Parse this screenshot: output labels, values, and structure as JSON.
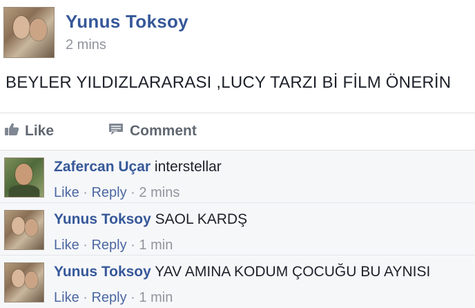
{
  "post": {
    "author": "Yunus Toksoy",
    "time": "2 mins",
    "text": "BEYLER YILDIZLARARASI ,LUCY TARZI Bİ FİLM ÖNERİN"
  },
  "actions": {
    "like_label": "Like",
    "comment_label": "Comment",
    "like_icon": "thumbs-up-icon",
    "comment_icon": "comment-icon"
  },
  "comments": [
    {
      "author": "Zafercan Uçar",
      "text": "interstellar",
      "like_label": "Like",
      "dot1": " · ",
      "reply_label": "Reply",
      "dot2": " · ",
      "time": "2 mins"
    },
    {
      "author": "Yunus Toksoy",
      "text": "SAOL KARDŞ",
      "like_label": "Like",
      "dot1": " · ",
      "reply_label": "Reply",
      "dot2": " · ",
      "time": "1 min"
    },
    {
      "author": "Yunus Toksoy",
      "text": "YAV AMINA KODUM ÇOCUĞU BU AYNISI",
      "like_label": "Like",
      "dot1": " · ",
      "reply_label": "Reply",
      "dot2": " · ",
      "time": "1 min"
    }
  ],
  "colors": {
    "author_link": "#365899",
    "meta": "#90949c",
    "action": "#606770",
    "comments_bg": "#f6f7f9"
  }
}
